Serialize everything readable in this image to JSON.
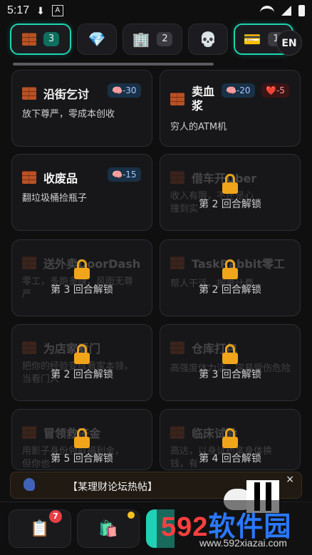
{
  "status_bar": {
    "time": "5:17"
  },
  "top_tabs": [
    {
      "icon": "brick-icon",
      "count": "3"
    },
    {
      "icon": "diamond-icon",
      "count": ""
    },
    {
      "icon": "building-icon",
      "count": "2"
    },
    {
      "icon": "skull-icon",
      "count": ""
    },
    {
      "icon": "money-icon",
      "count": "1"
    }
  ],
  "lang_button": "EN",
  "cards": [
    {
      "title": "沿街乞讨",
      "desc": "放下尊严，零成本创收",
      "tags": [
        {
          "type": "brain",
          "text": "🧠-30"
        }
      ]
    },
    {
      "title": "卖血\n浆",
      "desc": "穷人的ATM机",
      "tags": [
        {
          "type": "brain",
          "text": "🧠-20"
        },
        {
          "type": "heart",
          "text": "❤️-5"
        }
      ]
    },
    {
      "title": "收废品",
      "desc": "翻垃圾桶捡瓶子",
      "tags": [
        {
          "type": "brain",
          "text": "🧠-15"
        }
      ]
    },
    {
      "title": "借车开Uber",
      "desc": "收入有限，不还是心\n撞到实",
      "lock": "第 2 回合解锁"
    },
    {
      "title": "送外卖DoorDash",
      "desc": "零工，多跑多赚，风雨无尊\n严",
      "lock": "第 3 回合解锁"
    },
    {
      "title": "TaskRabbit零工",
      "desc": "帮人干活，按单计费",
      "lock": "第 2 回合解锁"
    },
    {
      "title": "为店家看门",
      "desc": "把你的经验变成看家本领，\n当看门人",
      "lock": "第 2 回合解锁"
    },
    {
      "title": "仓库打包",
      "desc": "高强度体力活，容易受伤危险",
      "lock": "第 3 回合解锁"
    },
    {
      "title": "冒领救济金",
      "desc": "用影子身份领取福利金，\n但你也",
      "lock": "第 5 回合解锁"
    },
    {
      "title": "临床试验",
      "desc": "高达，以身试药拿身体换\n钱，有",
      "lock": "第 4 回合解锁"
    }
  ],
  "banner": {
    "text": "【某理财论坛热帖】",
    "close": "×"
  },
  "bottom": {
    "tasks_badge": "7"
  },
  "watermark": {
    "big_a": "592",
    "big_b": "软件园",
    "url": "www.592xiazai.com"
  },
  "colors": {
    "accent_teal": "#1bd6b2",
    "lock_gold": "#f0a51b",
    "brain_tag": "#193146",
    "heart_tag": "#3a1515"
  }
}
